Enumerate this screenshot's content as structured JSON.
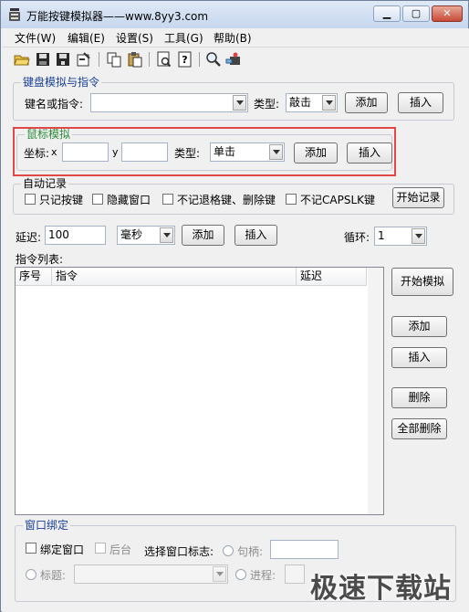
{
  "window": {
    "title": "万能按键模拟器——www.8yy3.com",
    "minimize": "▁",
    "maximize": "▢",
    "close": "✕"
  },
  "menu": [
    "文件(W)",
    "编辑(E)",
    "设置(S)",
    "工具(G)",
    "帮助(B)"
  ],
  "toolbar_icons": [
    "open-folder-icon",
    "save-icon",
    "save-as-icon",
    "properties-icon",
    "copy-icon",
    "paste-icon",
    "preview-icon",
    "help-icon",
    "search-icon",
    "run-icon"
  ],
  "keyboard": {
    "legend": "键盘模拟与指令",
    "key_label": "键名或指令:",
    "key_value": "",
    "type_label": "类型:",
    "type_value": "敲击",
    "add": "添加",
    "insert": "插入"
  },
  "mouse": {
    "legend": "鼠标模拟",
    "coord_label": "坐标:",
    "x_label": "x",
    "x_value": "",
    "y_label": "y",
    "y_value": "",
    "type_label": "类型:",
    "type_value": "单击",
    "add": "添加",
    "insert": "插入"
  },
  "auto_record": {
    "legend": "自动记录",
    "options": [
      {
        "label": "只记按键",
        "checked": false
      },
      {
        "label": "隐藏窗口",
        "checked": false
      },
      {
        "label": "不记退格键、删除键",
        "checked": false
      },
      {
        "label": "不记CAPSLK键",
        "checked": false
      }
    ],
    "start": "开始记录"
  },
  "delay": {
    "label": "延迟:",
    "value": "100",
    "unit": "毫秒",
    "add": "添加",
    "insert": "插入",
    "loop_label": "循环:",
    "loop_value": "1"
  },
  "command_list": {
    "label": "指令列表:",
    "columns": [
      "序号",
      "指令",
      "延迟"
    ],
    "rows": []
  },
  "side_buttons": {
    "start_sim": "开始模拟",
    "add": "添加",
    "insert": "插入",
    "delete": "删除",
    "delete_all": "全部删除"
  },
  "window_bind": {
    "legend": "窗口绑定",
    "bind_window": "绑定窗口",
    "background": "后台",
    "select_flag": "选择窗口标志:",
    "handle": "句柄:",
    "handle_value": "",
    "title": "标题:",
    "process": "进程:"
  },
  "watermark": "极速下载站",
  "colors": {
    "legend_blue": "#1a3f99",
    "legend_green": "#2c8a3a",
    "highlight_red": "#e14949"
  }
}
